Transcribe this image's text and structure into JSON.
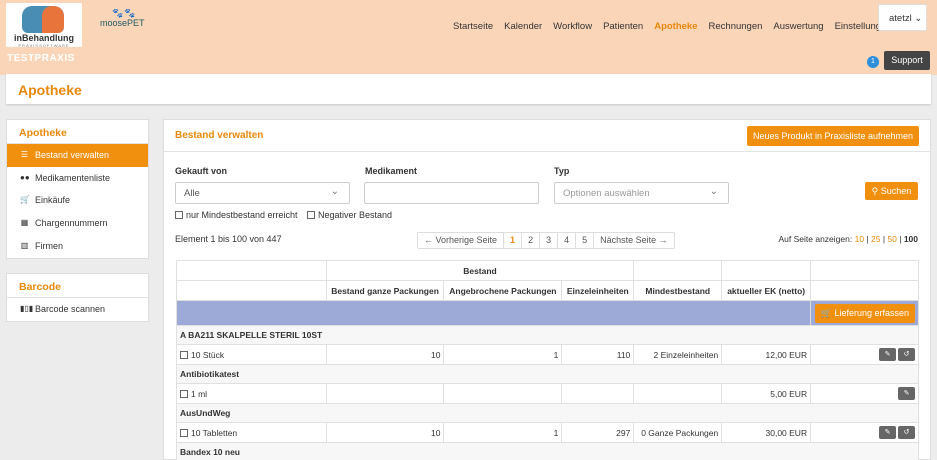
{
  "brand": {
    "logo_title": "inBehandlung",
    "logo_sub": "PRAXISSOFTWARE",
    "partner": "moosePET"
  },
  "nav": [
    "Startseite",
    "Kalender",
    "Workflow",
    "Patienten",
    "Apotheke",
    "Rechnungen",
    "Auswertung",
    "Einstellungen"
  ],
  "nav_active": "Apotheke",
  "user": "atetzl",
  "practice": "TESTPRAXIS",
  "notification_count": "1",
  "support_label": "Support",
  "page_title": "Apotheke",
  "sidebar": {
    "section1": "Apotheke",
    "items": [
      {
        "label": "Bestand verwalten",
        "icon": "list-icon"
      },
      {
        "label": "Medikamentenliste",
        "icon": "pills-icon"
      },
      {
        "label": "Einkäufe",
        "icon": "cart-icon"
      },
      {
        "label": "Chargennummern",
        "icon": "boxes-icon"
      },
      {
        "label": "Firmen",
        "icon": "building-icon"
      }
    ],
    "section2": "Barcode",
    "barcode_item": "Barcode scannen"
  },
  "main": {
    "title": "Bestand verwalten",
    "new_product": "Neues Produkt in Praxisliste aufnehmen",
    "filters": {
      "purchased_label": "Gekauft von",
      "purchased_value": "Alle",
      "medication_label": "Medikament",
      "medication_value": "",
      "type_label": "Typ",
      "type_placeholder": "Optionen auswählen",
      "search": "Suchen",
      "min_stock": "nur Mindestbestand erreicht",
      "negative_stock": "Negativer Bestand"
    },
    "range_text": "Element 1 bis 100 von 447",
    "pager": {
      "prev": "← Vorherige Seite",
      "pages": [
        "1",
        "2",
        "3",
        "4",
        "5"
      ],
      "next": "Nächste Seite →"
    },
    "per_page_label": "Auf Seite anzeigen:",
    "per_page_options": [
      "10",
      "25",
      "50",
      "100"
    ],
    "table": {
      "group_header": "Bestand",
      "columns": [
        "Bestand ganze Packungen",
        "Angebrochene Packungen",
        "Einzeleinheiten",
        "Mindestbestand",
        "aktueller EK (netto)"
      ],
      "delivery_button": "Lieferung erfassen",
      "groups": [
        {
          "name": "A BA211 SKALPELLE STERIL 10ST",
          "row": {
            "unit": "10 Stück",
            "whole": "10",
            "opened": "1",
            "single": "110",
            "min": "2 Einzeleinheiten",
            "ek": "12,00 EUR"
          }
        },
        {
          "name": "Antibiotikatest",
          "row": {
            "unit": "1 ml",
            "whole": "",
            "opened": "",
            "single": "",
            "min": "",
            "ek": "5,00 EUR"
          }
        },
        {
          "name": "AusUndWeg",
          "row": {
            "unit": "10 Tabletten",
            "whole": "10",
            "opened": "1",
            "single": "297",
            "min": "0 Ganze Packungen",
            "ek": "30,00 EUR"
          }
        },
        {
          "name": "Bandex 10 neu"
        }
      ]
    }
  },
  "colors": {
    "accent": "#f0900e",
    "header_bg": "#fbd5b8",
    "table_band": "#9daad8"
  }
}
